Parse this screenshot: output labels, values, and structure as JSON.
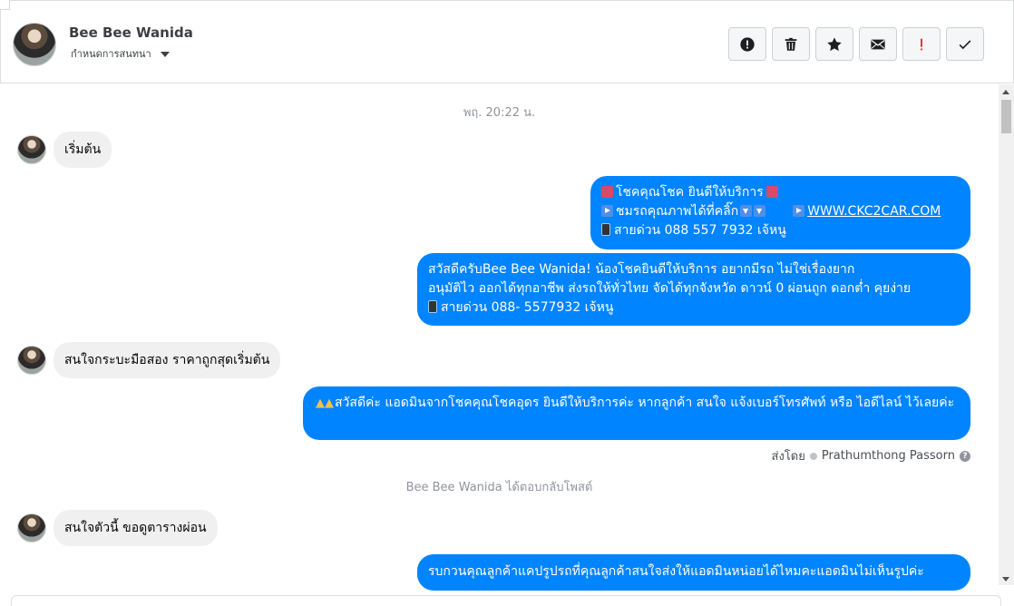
{
  "header": {
    "contact_name": "Bee Bee Wanida",
    "assign_label": "กำหนดการสนทนา",
    "actions": [
      {
        "name": "report-spam-button",
        "icon": "alert-circle-icon"
      },
      {
        "name": "delete-button",
        "icon": "trash-icon"
      },
      {
        "name": "star-button",
        "icon": "star-icon"
      },
      {
        "name": "mark-unread-button",
        "icon": "envelope-icon"
      },
      {
        "name": "follow-up-button",
        "icon": "exclamation-icon"
      },
      {
        "name": "mark-done-button",
        "icon": "checkmark-icon"
      }
    ]
  },
  "thread": {
    "timestamp": "พฤ. 20:22 น.",
    "messages": [
      {
        "direction": "in",
        "text": "เริ่มต้น"
      },
      {
        "direction": "out",
        "lines": [
          "โชคคุณโชค ยินดีให้บริการ",
          "ชมรถคุณภาพได้ที่คลิ๊ก",
          "WWW.CKC2CAR.COM",
          "สายด่วน 088 557 7932 เจ้หนู"
        ]
      },
      {
        "direction": "out",
        "lines": [
          "สวัสดีครับBee Bee Wanida! น้องโชคยินดีให้บริการ อยากมีรถ ไม่ใช่เรื่องยาก",
          "อนุมัติไว ออกได้ทุกอาชีพ ส่งรถให้ทั่วไทย จัดได้ทุกจังหวัด ดาวน์ 0  ผ่อนถูก ดอกต่ำ คุยง่าย",
          "สายด่วน 088- 5577932 เจ้หนู"
        ]
      },
      {
        "direction": "in",
        "text": "สนใจกระบะมือสอง ราคาถูกสุดเริ่มต้น"
      },
      {
        "direction": "out",
        "text": "สวัสดีค่ะ แอดมินจากโชคคุณโชคอุดร ยินดีให้บริการค่ะ หากลูกค้า สนใจ แจ้งเบอร์โทรศัพท์ หรือ ไอดีไลน์ ไว้เลยค่ะ"
      },
      {
        "direction": "in",
        "text": "สนใจตัวนี้ ขอดูตารางผ่อน"
      },
      {
        "direction": "out",
        "text": "รบกวนคุณลูกค้าแคปรูปรถที่คุณลูกค้าสนใจส่งให้แอดมินหน่อยได้ไหมคะแอดมินไม่เห็นรูปค่ะ"
      }
    ],
    "sent_by_label": "ส่งโดย",
    "sent_by_name": "Prathumthong Passorn",
    "reply_notice": "Bee Bee Wanida ได้ตอบกลับโพสต์"
  },
  "colors": {
    "outgoing_bubble": "#0084ff",
    "incoming_bubble": "#f1f0f0"
  }
}
